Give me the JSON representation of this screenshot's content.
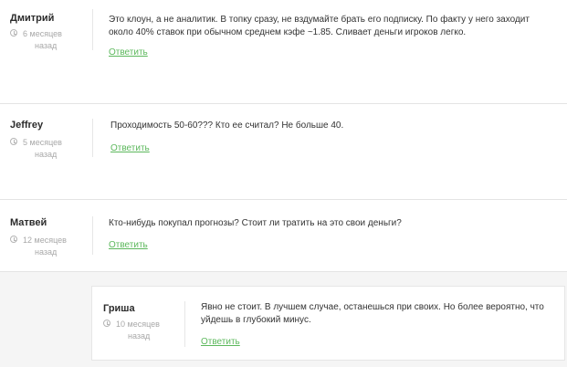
{
  "colors": {
    "link": "#5cb85c",
    "shaded_background": "#f5f5f5",
    "divider": "#e4e4e4"
  },
  "comments": [
    {
      "author": "Дмитрий",
      "ago_line1": "6 месяцев",
      "ago_line2": "назад",
      "text": "Это клоун, а не аналитик. В топку сразу, не вздумайте брать его подписку. По факту у него заходит около 40% ставок при обычном среднем кэфе ~1.85. Сливает деньги игроков легко.",
      "reply": "Ответить"
    },
    {
      "author": "Jeffrey",
      "ago_line1": "5 месяцев",
      "ago_line2": "назад",
      "text": "Проходимость 50-60??? Кто ее считал? Не больше 40.",
      "reply": "Ответить"
    },
    {
      "author": "Матвей",
      "ago_line1": "12 месяцев",
      "ago_line2": "назад",
      "text": "Кто-нибудь покупал прогнозы? Стоит ли тратить на это свои деньги?",
      "reply": "Ответить"
    }
  ],
  "reply_comment": {
    "author": "Гриша",
    "ago_line1": "10 месяцев",
    "ago_line2": "назад",
    "text": "Явно не стоит. В лучшем случае, останешься при своих. Но более вероятно, что уйдешь в глубокий минус.",
    "reply": "Ответить"
  }
}
